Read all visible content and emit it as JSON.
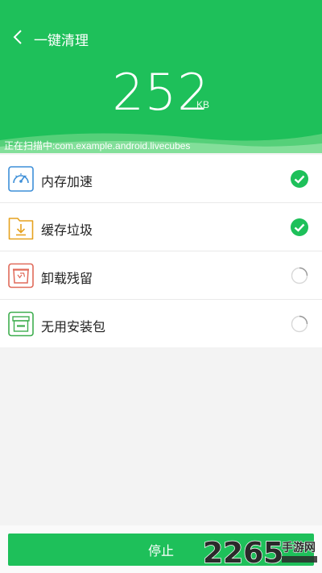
{
  "header": {
    "title": "一键清理",
    "back_icon": "chevron-left-icon",
    "size_value": "252",
    "size_unit": "KB",
    "scan_status": "正在扫描中:com.example.android.livecubes"
  },
  "items": [
    {
      "label": "内存加速",
      "icon": "speedometer-icon",
      "status": "done"
    },
    {
      "label": "缓存垃圾",
      "icon": "folder-download-icon",
      "status": "done"
    },
    {
      "label": "卸载残留",
      "icon": "archive-box-icon",
      "status": "scanning"
    },
    {
      "label": "无用安装包",
      "icon": "apk-package-icon",
      "status": "scanning"
    }
  ],
  "footer": {
    "stop_label": "停止"
  },
  "watermark": {
    "number": "2265",
    "text": "手游网"
  },
  "colors": {
    "accent": "#1ec05a",
    "blue": "#3d8fd8",
    "orange": "#e6a21f",
    "red": "#e06a5a",
    "green_icon": "#3fae4f"
  }
}
